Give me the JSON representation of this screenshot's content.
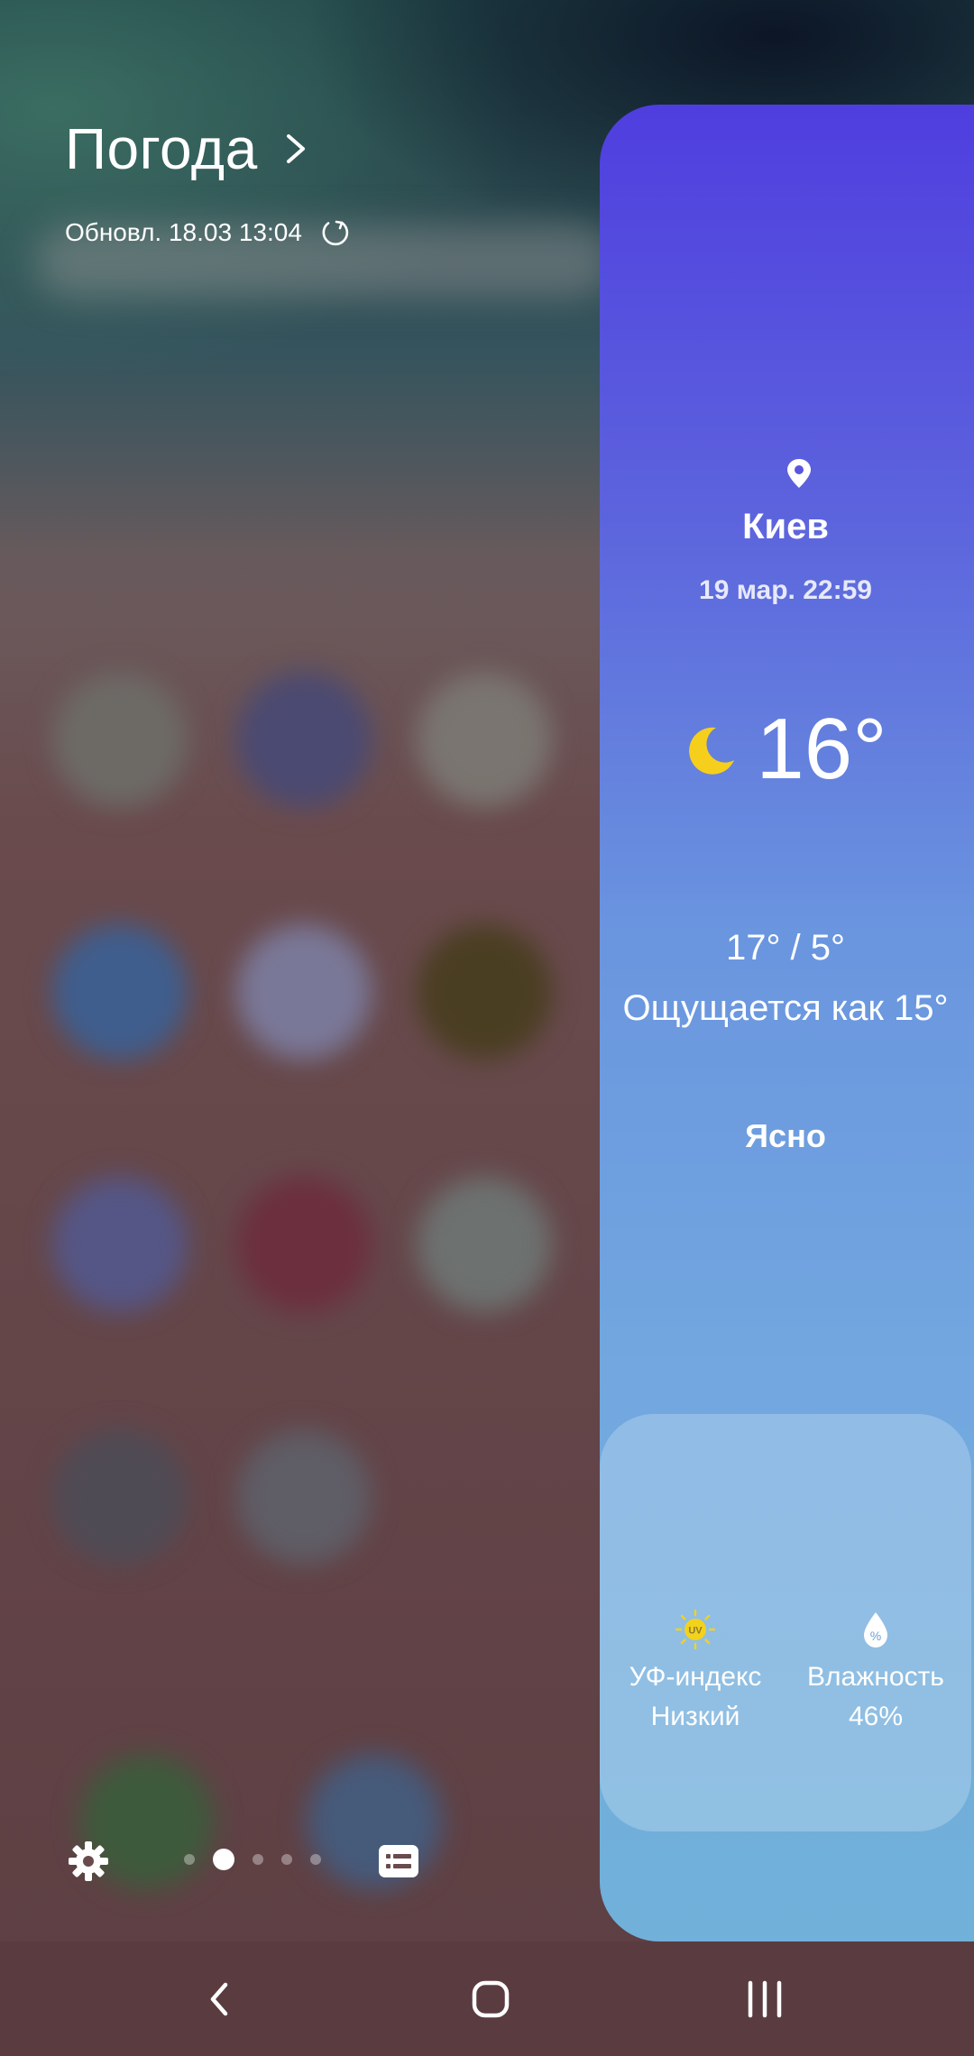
{
  "widget": {
    "title": "Погода",
    "updated": "Обновл. 18.03 13:04"
  },
  "weather": {
    "city": "Киев",
    "datetime": "19 мар. 22:59",
    "temperature": "16°",
    "high_low": "17° / 5°",
    "feels_like": "Ощущается как 15°",
    "condition": "Ясно",
    "uv": {
      "label": "УФ-индекс",
      "value": "Низкий",
      "icon_text": "UV"
    },
    "humidity": {
      "label": "Влажность",
      "value": "46%",
      "icon_text": "%"
    }
  },
  "pager": {
    "total_pages": 5,
    "active_page": 2
  },
  "icons": {
    "title_chevron": "chevron-right-icon",
    "refresh": "refresh-icon",
    "location": "location-pin-icon",
    "condition": "moon-icon",
    "uv": "uv-sun-icon",
    "humidity": "humidity-drop-icon",
    "settings": "gear-icon",
    "list": "list-icon",
    "nav_back": "back-icon",
    "nav_home": "home-icon",
    "nav_recents": "recents-icon"
  },
  "colors": {
    "moon": "#f5cf1c",
    "uv_icon": "#f3d21c",
    "panel_top": "#4f3edf",
    "panel_bottom": "#71b1d9",
    "navbar": "#5a3c40"
  }
}
